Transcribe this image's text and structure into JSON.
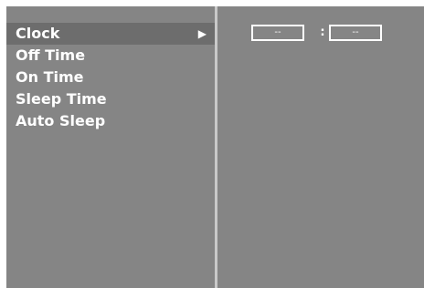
{
  "menu": {
    "items": [
      {
        "label": "Clock",
        "selected": true
      },
      {
        "label": "Off Time",
        "selected": false
      },
      {
        "label": "On Time",
        "selected": false
      },
      {
        "label": "Sleep Time",
        "selected": false
      },
      {
        "label": "Auto Sleep",
        "selected": false
      }
    ],
    "submenu_arrow": "▶"
  },
  "clock": {
    "hours": "--",
    "separator": ":",
    "minutes": "--"
  }
}
